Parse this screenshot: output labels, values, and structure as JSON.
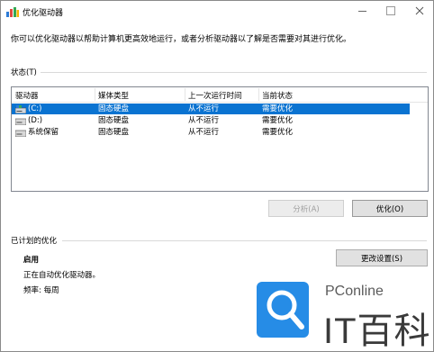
{
  "window": {
    "title": "优化驱动器"
  },
  "description": "你可以优化驱动器以帮助计算机更高效地运行，或者分析驱动器以了解是否需要对其进行优化。",
  "status_section": {
    "label": "状态(T)"
  },
  "table": {
    "columns": [
      "驱动器",
      "媒体类型",
      "上一次运行时间",
      "当前状态"
    ],
    "rows": [
      {
        "drive": "(C:)",
        "media": "固态硬盘",
        "last_run": "从不运行",
        "status": "需要优化",
        "selected": true,
        "icon": "system-drive-icon"
      },
      {
        "drive": "(D:)",
        "media": "固态硬盘",
        "last_run": "从不运行",
        "status": "需要优化",
        "selected": false,
        "icon": "drive-icon"
      },
      {
        "drive": "系统保留",
        "media": "固态硬盘",
        "last_run": "从不运行",
        "status": "需要优化",
        "selected": false,
        "icon": "drive-icon"
      }
    ]
  },
  "buttons": {
    "analyze": "分析(A)",
    "optimize": "优化(O)",
    "change_settings": "更改设置(S)"
  },
  "scheduled": {
    "label": "已计划的优化",
    "state": "启用",
    "detail": "正在自动优化驱动器。",
    "frequency": "频率: 每周"
  },
  "watermark": {
    "brand": "PConline",
    "text": "IT百科"
  },
  "colors": {
    "selection": "#0a73d1",
    "accent": "#1e88e5"
  }
}
